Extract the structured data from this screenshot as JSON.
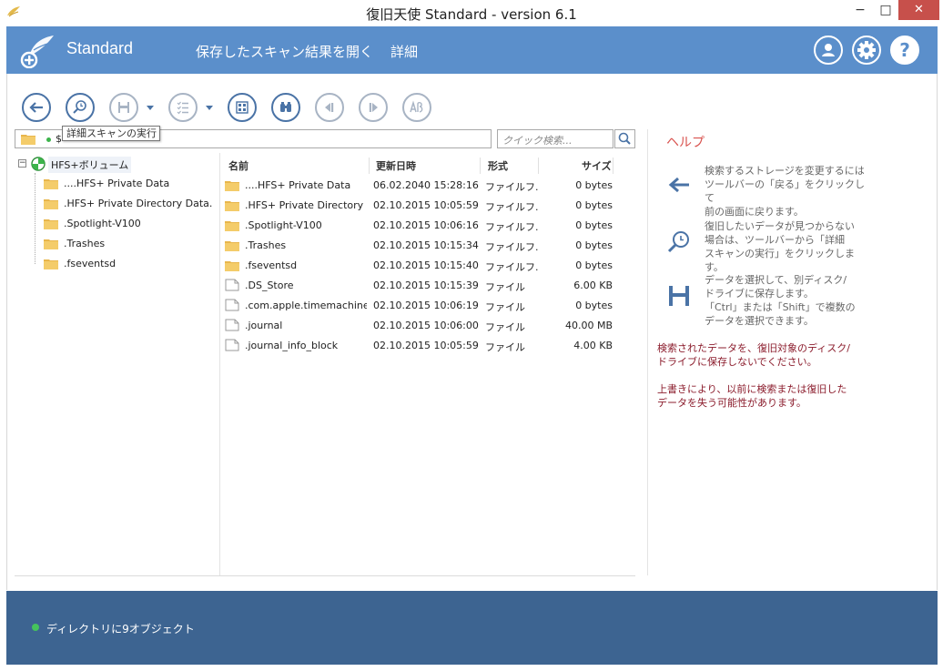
{
  "window": {
    "title": "復旧天使 Standard - version 6.1",
    "min_glyph": "−",
    "max_glyph": "□",
    "close_glyph": "✕"
  },
  "header": {
    "brand": "Standard",
    "nav_open_results": "保存したスキャン結果を開く",
    "nav_detail": "詳細",
    "help_glyph": "?"
  },
  "toolbar": {
    "tooltip": "詳細スキャンの実行"
  },
  "pathbar": {
    "path": "$"
  },
  "search": {
    "placeholder": "クイック検索..."
  },
  "tree": {
    "expander": "−",
    "root": "HFS+ボリューム",
    "items": [
      "....HFS+ Private Data",
      ".HFS+ Private Directory Data.",
      ".Spotlight-V100",
      ".Trashes",
      ".fseventsd"
    ]
  },
  "list": {
    "columns": {
      "name": "名前",
      "date": "更新日時",
      "type": "形式",
      "size": "サイズ"
    },
    "rows": [
      {
        "name": "....HFS+ Private Data",
        "date": "06.02.2040 15:28:16",
        "type": "ファイルフ...",
        "size": "0 bytes",
        "kind": "folder"
      },
      {
        "name": ".HFS+ Private Directory ...",
        "date": "02.10.2015 10:05:59",
        "type": "ファイルフ...",
        "size": "0 bytes",
        "kind": "folder"
      },
      {
        "name": ".Spotlight-V100",
        "date": "02.10.2015 10:06:16",
        "type": "ファイルフ...",
        "size": "0 bytes",
        "kind": "folder"
      },
      {
        "name": ".Trashes",
        "date": "02.10.2015 10:15:34",
        "type": "ファイルフ...",
        "size": "0 bytes",
        "kind": "folder"
      },
      {
        "name": ".fseventsd",
        "date": "02.10.2015 10:15:40",
        "type": "ファイルフ...",
        "size": "0 bytes",
        "kind": "folder"
      },
      {
        "name": ".DS_Store",
        "date": "02.10.2015 10:15:39",
        "type": "ファイル",
        "size": "6.00 KB",
        "kind": "file"
      },
      {
        "name": ".com.apple.timemachine....",
        "date": "02.10.2015 10:06:19",
        "type": "ファイル",
        "size": "0 bytes",
        "kind": "file"
      },
      {
        "name": ".journal",
        "date": "02.10.2015 10:06:00",
        "type": "ファイル",
        "size": "40.00 MB",
        "kind": "file"
      },
      {
        "name": ".journal_info_block",
        "date": "02.10.2015 10:05:59",
        "type": "ファイル",
        "size": "4.00 KB",
        "kind": "file"
      }
    ]
  },
  "help": {
    "title": "ヘルプ",
    "back_lines": [
      "検索するストレージを変更するには",
      "ツールバーの「戻る」をクリックして",
      "前の画面に戻ります。"
    ],
    "scan_lines": [
      "復旧したいデータが見つからない",
      "場合は、ツールバーから「詳細",
      "スキャンの実行」をクリックします。"
    ],
    "save_lines": [
      "データを選択して、別ディスク/",
      "ドライブに保存します。",
      "「Ctrl」または「Shift」で複数の",
      "データを選択できます。"
    ],
    "warn1_lines": [
      "検索されたデータを、復旧対象のディスク/",
      "ドライブに保存しないでください。"
    ],
    "warn2_lines": [
      "上書きにより、以前に検索または復旧した",
      "データを失う可能性があります。"
    ]
  },
  "status": {
    "text": "ディレクトリに9オブジェクト"
  },
  "colors": {
    "header_blue": "#5b8fcb",
    "status_blue": "#3d6491",
    "accent_red": "#d9534f",
    "warning_text": "#8b1c2c",
    "status_green": "#45c35c"
  }
}
